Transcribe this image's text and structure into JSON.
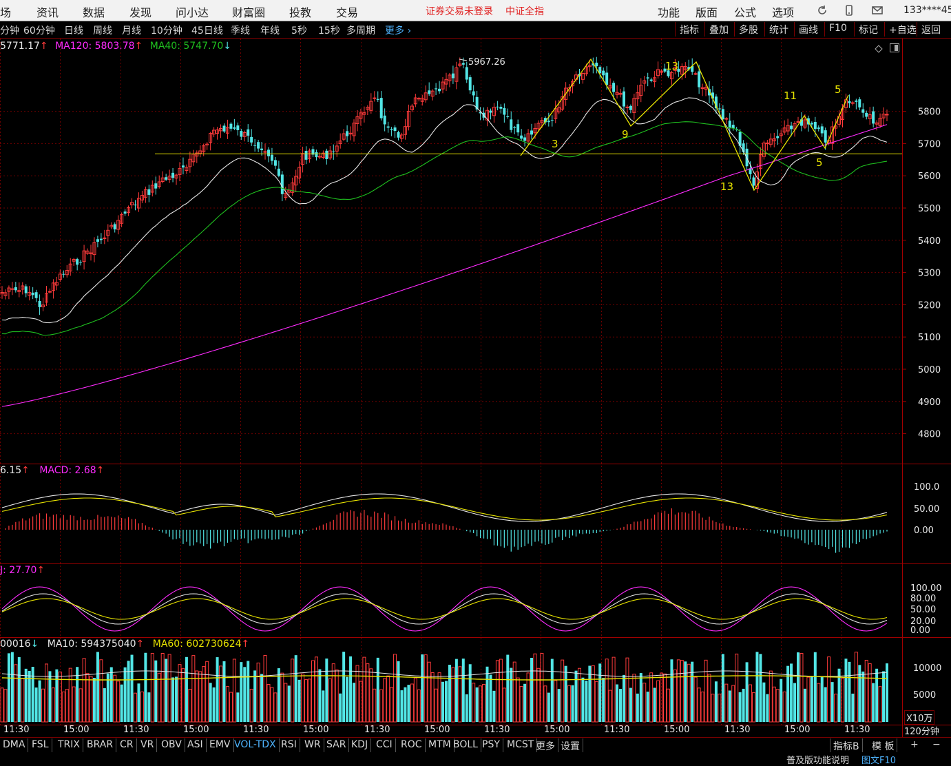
{
  "top_menu": {
    "items": [
      "场",
      "资讯",
      "数据",
      "发现",
      "问小达",
      "财富圈",
      "投教",
      "交易"
    ],
    "alert": "证券交易未登录",
    "index_name": "中证全指",
    "right_items": [
      "功能",
      "版面",
      "公式",
      "选项"
    ],
    "account": "133****45"
  },
  "period_bar": {
    "periods": [
      "分钟",
      "60分钟",
      "日线",
      "周线",
      "月线",
      "10分钟",
      "45日线",
      "季线",
      "年线",
      "5秒",
      "15秒",
      "多周期"
    ],
    "more_label": "更多",
    "tools": [
      "指标",
      "叠加",
      "多股",
      "统计",
      "画线",
      "F10",
      "标记",
      "+自选",
      "返回"
    ]
  },
  "main_indicator": {
    "values": [
      "5771.17",
      "MA120: 5803.78",
      "MA40: 5747.70"
    ],
    "high_label": "5967.26",
    "wave_labels": [
      "3",
      "9",
      "13",
      "11",
      "5",
      "13",
      "5"
    ]
  },
  "price_axis": [
    "5800",
    "5700",
    "5600",
    "5500",
    "5400",
    "5300",
    "5200",
    "5100",
    "5000",
    "4900",
    "4800"
  ],
  "macd": {
    "values": [
      "6.15",
      "MACD: 2.68"
    ],
    "axis": [
      "100.0",
      "50.00",
      "0.00"
    ]
  },
  "kdj": {
    "values": [
      "J: 27.70"
    ],
    "axis": [
      "100.00",
      "80.00",
      "50.00",
      "20.00",
      "0.00"
    ]
  },
  "volume": {
    "values": [
      "00016",
      "MA10: 594375040",
      "MA60: 602730624"
    ],
    "axis": [
      "10000",
      "5000"
    ],
    "unit": "X10万"
  },
  "time_axis": [
    "11:30",
    "15:00",
    "11:30",
    "15:00",
    "11:30",
    "15:00",
    "11:30",
    "15:00",
    "11:30",
    "15:00",
    "11:30",
    "15:00",
    "11:30",
    "15:00",
    "11:30"
  ],
  "period_label": "120分钟",
  "indicator_tabs": [
    "DMA",
    "FSL",
    "TRIX",
    "BRAR",
    "CR",
    "VR",
    "OBV",
    "ASI",
    "EMV",
    "VOL-TDX",
    "RSI",
    "WR",
    "SAR",
    "KDJ",
    "CCI",
    "ROC",
    "MTM",
    "BOLL",
    "PSY",
    "MCST",
    "更多",
    "设置"
  ],
  "active_tab": "VOL-TDX",
  "right_tabs": [
    "指标B",
    "模 板",
    "+",
    "−"
  ],
  "status": {
    "help": "普及版功能说明",
    "f10": "图文F10"
  },
  "colors": {
    "up": "#ff3b3b",
    "down": "#52e6e6",
    "ma_white": "#e6e6e6",
    "ma_yellow": "#e8e400",
    "ma_green": "#1fbf1f",
    "ma_magenta": "#ff2bff",
    "grid": "#6e0000",
    "axis_text": "#e8e8e8"
  },
  "chart_data": {
    "type": "candlestick",
    "series": [
      {
        "name": "MA120",
        "last": 5803.78
      },
      {
        "name": "MA40",
        "last": 5747.7
      }
    ],
    "price_high": 5967.26,
    "support_level": 5668,
    "ylim": [
      4760,
      6000
    ]
  }
}
